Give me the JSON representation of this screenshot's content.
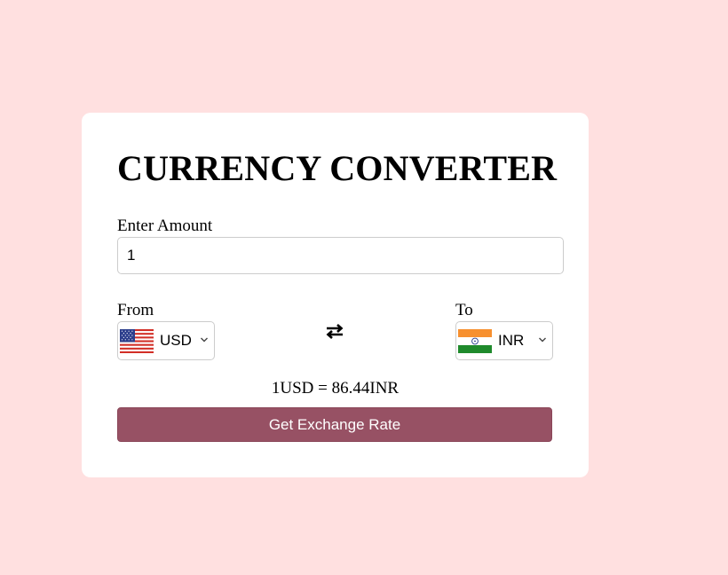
{
  "converter": {
    "title": "CURRENCY CONVERTER",
    "amount_label": "Enter Amount",
    "amount_value": "1",
    "from_label": "From",
    "to_label": "To",
    "from_currency": "USD",
    "to_currency": "INR",
    "from_flag": "us-flag-icon",
    "to_flag": "india-flag-icon",
    "swap_icon": "swap-arrows-icon",
    "result_text": "1USD = 86.44INR",
    "button_label": "Get Exchange Rate"
  },
  "colors": {
    "page_background": "#ffe0e0",
    "card_background": "#ffffff",
    "button_background": "#975164",
    "button_text": "#ffffff"
  }
}
